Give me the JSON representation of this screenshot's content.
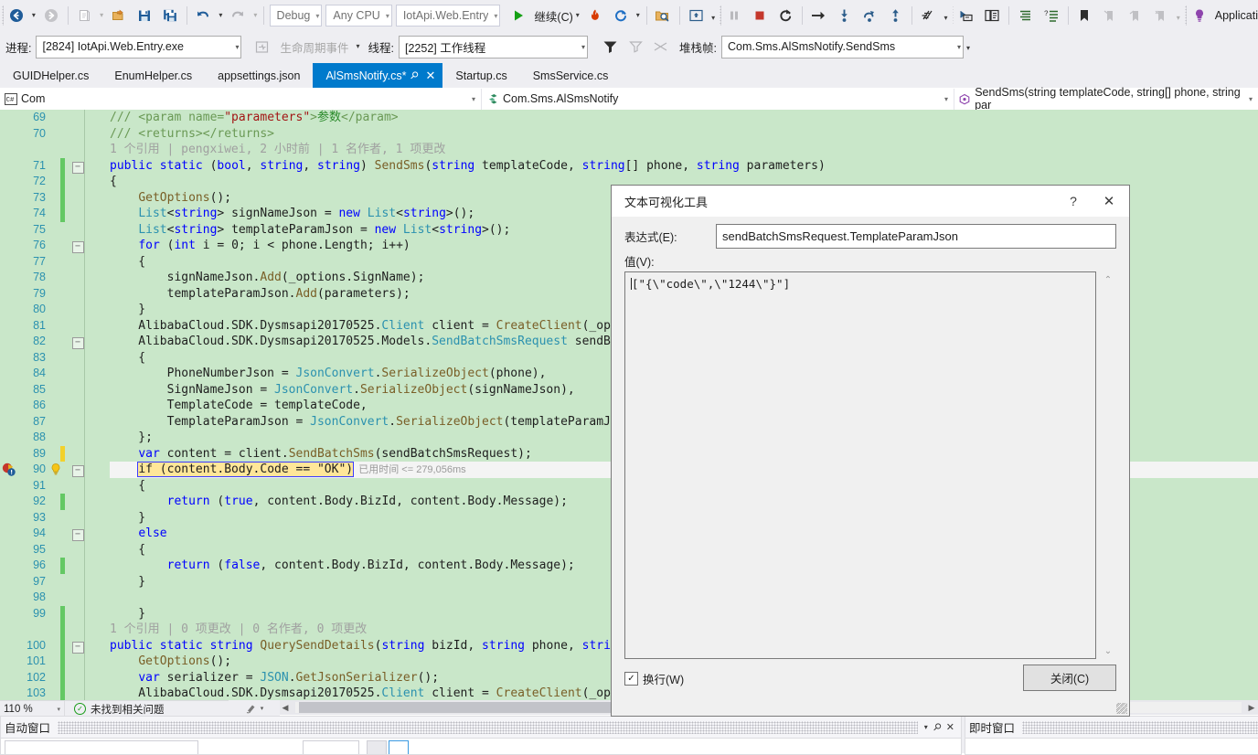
{
  "toolbar_main": {
    "nav_back": "navigate-backward",
    "nav_forward": "navigate-forward",
    "new_item": "new-item",
    "open_file": "open-file",
    "save": "save",
    "save_all": "save-all",
    "undo": "undo",
    "redo": "redo",
    "debug_config": "Debug",
    "platform": "Any CPU",
    "startup_project": "IotApi.Web.Entry",
    "continue_label": "继续(C)",
    "hot_reload": "hot-reload-icon",
    "restart_app": "restart-icon",
    "find_in_files": "find-in-files-icon",
    "step_into_specific": "step-into-specific-icon",
    "pause": "pause-icon",
    "stop": "stop-icon",
    "restart": "restart-debug-icon",
    "show_next": "show-next-statement-icon",
    "step_into": "step-into-icon",
    "step_over": "step-over-icon",
    "step_out": "step-out-icon",
    "threads": "threads-icon",
    "sel1": "sel-icon-1",
    "sel2": "sel-icon-2",
    "list1": "list-icon-1",
    "list2": "list-icon-2",
    "bookmark": "bookmark-icon",
    "bm1": "bookmark-prev-icon",
    "bm2": "bookmark-next-icon",
    "bm3": "bookmark-clear-icon",
    "app_insights": "Applicati"
  },
  "toolbar_debug": {
    "process_label": "进程:",
    "process_value": "[2824] IotApi.Web.Entry.exe",
    "lifecycle_label": "生命周期事件",
    "thread_label": "线程:",
    "thread_value": "[2252] 工作线程",
    "filter_icon": "filter-icon",
    "flag_icon": "flag-icon",
    "noflag_icon": "no-flag-icon",
    "stackframe_label": "堆栈帧:",
    "stackframe_value": "Com.Sms.AlSmsNotify.SendSms"
  },
  "tabs": [
    {
      "label": "GUIDHelper.cs",
      "active": false
    },
    {
      "label": "EnumHelper.cs",
      "active": false
    },
    {
      "label": "appsettings.json",
      "active": false
    },
    {
      "label": "AlSmsNotify.cs*",
      "active": true
    },
    {
      "label": "Startup.cs",
      "active": false
    },
    {
      "label": "SmsService.cs",
      "active": false
    }
  ],
  "navbar": {
    "project_icon": "csharp-project-icon",
    "project": "Com",
    "type_icon": "class-icon",
    "type": "Com.Sms.AlSmsNotify",
    "member_icon": "method-icon",
    "member": "SendSms(string templateCode, string[] phone, string par"
  },
  "editor": {
    "zoom": "110 %",
    "status_text": "未找到相关问题",
    "perf_tip": "已用时间 <= 279,056ms",
    "lines": [
      {
        "num": "69",
        "html": "<span class=\"cm\">/// &lt;param name=</span><span class=\"s\">\"parameters\"</span><span class=\"cm\">&gt;</span><span class=\"cm\" style=\"color:#2a8a2a\">参数</span><span class=\"cm\">&lt;/param&gt;</span>",
        "indent": 0
      },
      {
        "num": "70",
        "html": "<span class=\"cm\">/// &lt;returns&gt;&lt;/returns&gt;</span>"
      },
      {
        "num": "",
        "html": "<span class=\"cz\">1 个引用 | pengxiwei, 2 小时前 | 1 名作者, 1 项更改</span>",
        "codelens": true
      },
      {
        "num": "71",
        "html": "<span class=\"k\">public</span> <span class=\"k\">static</span> (<span class=\"k\">bool</span>, <span class=\"k\">string</span>, <span class=\"k\">string</span>) <span class=\"m\">SendSms</span>(<span class=\"k\">string</span> templateCode, <span class=\"k\">string</span>[] phone, <span class=\"k\">string</span> parameters)",
        "glyph": "-",
        "chg": "green"
      },
      {
        "num": "72",
        "html": "{",
        "chg": "green"
      },
      {
        "num": "73",
        "html": "    <span class=\"m\">GetOptions</span>();",
        "chg": "green"
      },
      {
        "num": "74",
        "html": "    <span class=\"t\">List</span>&lt;<span class=\"k\">string</span>&gt; signNameJson = <span class=\"k\">new</span> <span class=\"t\">List</span>&lt;<span class=\"k\">string</span>&gt;();",
        "chg": "green"
      },
      {
        "num": "75",
        "html": "    <span class=\"t\">List</span>&lt;<span class=\"k\">string</span>&gt; templateParamJson = <span class=\"k\">new</span> <span class=\"t\">List</span>&lt;<span class=\"k\">string</span>&gt;();"
      },
      {
        "num": "76",
        "html": "    <span class=\"k\">for</span> (<span class=\"k\">int</span> i = <span class=\"p\">0</span>; i &lt; phone.Length; i++)",
        "glyph": "-"
      },
      {
        "num": "77",
        "html": "    {"
      },
      {
        "num": "78",
        "html": "        signNameJson.<span class=\"m\">Add</span>(_options.SignName);"
      },
      {
        "num": "79",
        "html": "        templateParamJson.<span class=\"m\">Add</span>(parameters);"
      },
      {
        "num": "80",
        "html": "    }"
      },
      {
        "num": "81",
        "html": "    AlibabaCloud.SDK.Dysmsapi20170525.<span class=\"t\">Client</span> client = <span class=\"m\">CreateClient</span>(_opti"
      },
      {
        "num": "82",
        "html": "    AlibabaCloud.SDK.Dysmsapi20170525.Models.<span class=\"t\">SendBatchSmsRequest</span> sendBat",
        "glyph": "-"
      },
      {
        "num": "83",
        "html": "    {"
      },
      {
        "num": "84",
        "html": "        PhoneNumberJson = <span class=\"t\">JsonConvert</span>.<span class=\"m\">SerializeObject</span>(phone),"
      },
      {
        "num": "85",
        "html": "        SignNameJson = <span class=\"t\">JsonConvert</span>.<span class=\"m\">SerializeObject</span>(signNameJson),"
      },
      {
        "num": "86",
        "html": "        TemplateCode = templateCode,"
      },
      {
        "num": "87",
        "html": "        TemplateParamJson = <span class=\"t\">JsonConvert</span>.<span class=\"m\">SerializeObject</span>(templateParamJso"
      },
      {
        "num": "88",
        "html": "    };"
      },
      {
        "num": "89",
        "html": "    <span class=\"k\">var</span> content = client.<span class=\"m\">SendBatchSms</span>(sendBatchSmsRequest);",
        "chg": "pend"
      },
      {
        "num": "90",
        "html": "SPECIAL_LINE_90",
        "glyph": "-",
        "bulb": true,
        "breakpoint": true,
        "current": true
      },
      {
        "num": "91",
        "html": "    {"
      },
      {
        "num": "92",
        "html": "        <span class=\"k\">return</span> (<span class=\"k\">true</span>, content.Body.BizId, content.Body.Message);",
        "chg": "green"
      },
      {
        "num": "93",
        "html": "    }"
      },
      {
        "num": "94",
        "html": "    <span class=\"k\">else</span>",
        "glyph": "-"
      },
      {
        "num": "95",
        "html": "    {"
      },
      {
        "num": "96",
        "html": "        <span class=\"k\">return</span> (<span class=\"k\">false</span>, content.Body.BizId, content.Body.Message);",
        "chg": "green"
      },
      {
        "num": "97",
        "html": "    }"
      },
      {
        "num": "98",
        "html": ""
      },
      {
        "num": "99",
        "html": "    }",
        "chg": "green"
      },
      {
        "num": "",
        "html": "<span class=\"cz\">1 个引用 | 0 项更改 | 0 名作者, 0 项更改</span>",
        "codelens": true,
        "chg": "green"
      },
      {
        "num": "100",
        "html": "<span class=\"k\">public</span> <span class=\"k\">static</span> <span class=\"k\">string</span> <span class=\"m\">QuerySendDetails</span>(<span class=\"k\">string</span> bizId, <span class=\"k\">string</span> phone, <span class=\"k\">string</span> s",
        "glyph": "-",
        "chg": "green"
      },
      {
        "num": "101",
        "html": "    <span class=\"m\">GetOptions</span>();",
        "chg": "green"
      },
      {
        "num": "102",
        "html": "    <span class=\"k\">var</span> serializer = <span class=\"t\">JSON</span>.<span class=\"m\">GetJsonSerializer</span>();",
        "chg": "green"
      },
      {
        "num": "103",
        "html": "    AlibabaCloud.SDK.Dysmsapi20170525.<span class=\"t\">Client</span> client = <span class=\"m\">CreateClient</span>(_opti",
        "chg": "green"
      }
    ],
    "line90_prefix": "    ",
    "line90_code": "if (content.Body.Code == \"OK\")"
  },
  "dialog": {
    "title": "文本可视化工具",
    "help_label": "?",
    "close_label": "✕",
    "expression_label": "表达式(E):",
    "expression_value": "sendBatchSmsRequest.TemplateParamJson",
    "value_label": "值(V):",
    "value_text": "[\"{\\\"code\\\",\\\"1244\\\"}\"]",
    "wrap_label": "换行(W)",
    "wrap_checked": "✓",
    "close_button": "关闭(C)",
    "scroll_up": "⌃",
    "scroll_down": "⌄"
  },
  "bottom_panels": {
    "autos": {
      "title": "自动窗口",
      "dropdown": "▾",
      "pin": "pin-icon",
      "close": "✕"
    },
    "immediate": {
      "title": "即时窗口"
    }
  },
  "colors": {
    "accent": "#007acc",
    "editor_bg": "#c9e7c9",
    "chrome": "#eeeef2",
    "changebar_saved": "#64c864",
    "changebar_pending": "#f2d12c",
    "highlight": "#ffe699"
  }
}
